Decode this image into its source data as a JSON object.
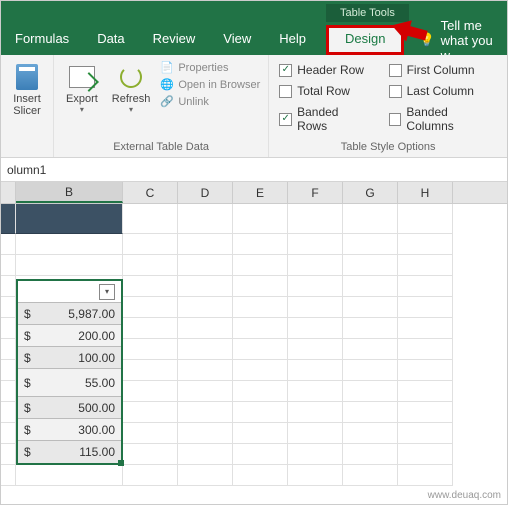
{
  "titlebar": {
    "tools_label": "Table Tools"
  },
  "ribbon_tabs": {
    "formulas": "Formulas",
    "data": "Data",
    "review": "Review",
    "view": "View",
    "help": "Help",
    "design": "Design",
    "tell_me": "Tell me what you w"
  },
  "ribbon": {
    "insert_slicer": "Insert\nSlicer",
    "export": "Export",
    "refresh": "Refresh",
    "properties": "Properties",
    "open_browser": "Open in Browser",
    "unlink": "Unlink",
    "group_external": "External Table Data",
    "opts": {
      "header_row": "Header Row",
      "total_row": "Total Row",
      "banded_rows": "Banded Rows",
      "first_column": "First Column",
      "last_column": "Last Column",
      "banded_columns": "Banded Columns",
      "group_label": "Table Style Options"
    }
  },
  "formula_bar": {
    "text": "olumn1"
  },
  "columns": [
    "B",
    "C",
    "D",
    "E",
    "F",
    "G",
    "H"
  ],
  "table": {
    "header": "",
    "rows": [
      {
        "currency": "$",
        "value": "5,987.00"
      },
      {
        "currency": "$",
        "value": "200.00"
      },
      {
        "currency": "$",
        "value": "100.00"
      },
      {
        "currency": "$",
        "value": "55.00"
      },
      {
        "currency": "$",
        "value": "500.00"
      },
      {
        "currency": "$",
        "value": "300.00"
      },
      {
        "currency": "$",
        "value": "115.00"
      }
    ]
  },
  "watermark": "www.deuaq.com"
}
